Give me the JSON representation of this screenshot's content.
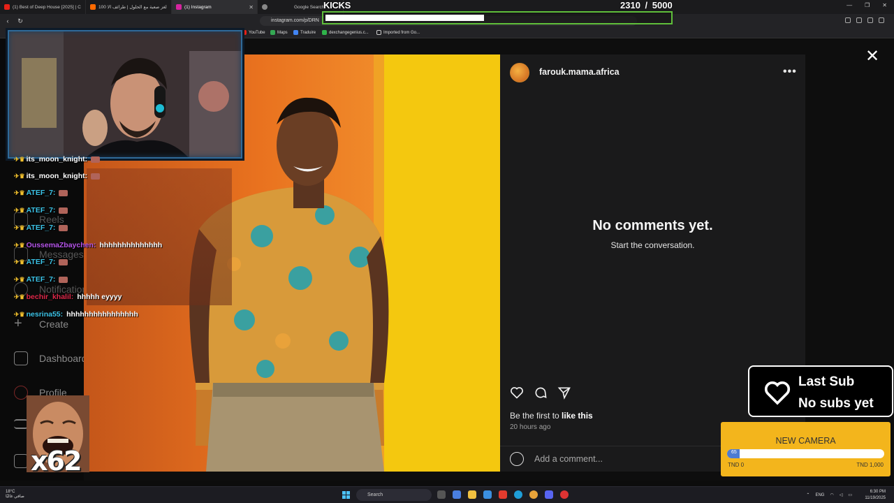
{
  "browser": {
    "tabs": [
      {
        "title": "(1) Best of Deep House [2025] | C",
        "favicon_color": "#e62117"
      },
      {
        "title": "100 لغز صعبة مع الحلول | طرائف الا",
        "favicon_color": "#ff6a00"
      },
      {
        "title": "(1) Instagram",
        "favicon_color": "#d6249f"
      },
      {
        "title": "Google Search",
        "favicon_color": "#888888"
      }
    ],
    "url": "instagram.com/p/DRN",
    "bookmarks": [
      "YouTube",
      "Maps",
      "Traduire",
      "dexchangegenius.c...",
      "Imported from Go..."
    ]
  },
  "kicks_goal": {
    "label": "KICKS",
    "current": 2310,
    "separator": "/",
    "target": 5000,
    "progress": 0.462,
    "bar_color": "#5fbf3a"
  },
  "instagram": {
    "sidebar": [
      "Reels",
      "Messages",
      "Notifications",
      "Create",
      "Dashboard",
      "Profile"
    ],
    "post": {
      "username": "farouk.mama.africa",
      "more_icon": "more-horizontal-icon",
      "empty_title": "No comments yet.",
      "empty_subtitle": "Start the conversation.",
      "likes_prefix": "Be the first to",
      "likes_action": "like this",
      "timestamp": "20 hours ago",
      "comment_placeholder": "Add a comment..."
    },
    "photo_colors": {
      "left_wall": "#e8701e",
      "right_wall": "#f4c70f"
    }
  },
  "stream": {
    "chat": [
      {
        "user": "its_moon_knight:",
        "user_color": "#ffffff",
        "message": ""
      },
      {
        "user": "its_moon_knight:",
        "user_color": "#ffffff",
        "message": ""
      },
      {
        "user": "ATEF_7:",
        "user_color": "#3cc4e8",
        "message": ""
      },
      {
        "user": "ATEF_7:",
        "user_color": "#3cc4e8",
        "message": ""
      },
      {
        "user": "ATEF_7:",
        "user_color": "#3cc4e8",
        "message": ""
      },
      {
        "user": "OussemaZbaychen:",
        "user_color": "#b454e8",
        "message": "hhhhhhhhhhhhhh"
      },
      {
        "user": "ATEF_7:",
        "user_color": "#3cc4e8",
        "message": ""
      },
      {
        "user": "ATEF_7:",
        "user_color": "#3cc4e8",
        "message": ""
      },
      {
        "user": "bechir_khalil:",
        "user_color": "#e0284a",
        "message": "hhhhh eyyyy"
      },
      {
        "user": "nesrina55:",
        "user_color": "#3cc4e8",
        "message": "hhhhhhhhhhhhhhhh"
      }
    ],
    "meme_text": "x62",
    "last_sub": {
      "title": "Last Sub",
      "value": "No subs yet"
    },
    "donation_goal": {
      "title": "NEW CAMERA",
      "current_label": "65",
      "progress": 0.065,
      "min_label": "TND 0",
      "max_label": "TND 1,000"
    }
  },
  "taskbar": {
    "weather_temp": "18°C",
    "weather_desc": "صافي غالبًا",
    "search_label": "Search",
    "language": "ENG",
    "time": "6:30 PM",
    "date": "11/19/2025"
  }
}
